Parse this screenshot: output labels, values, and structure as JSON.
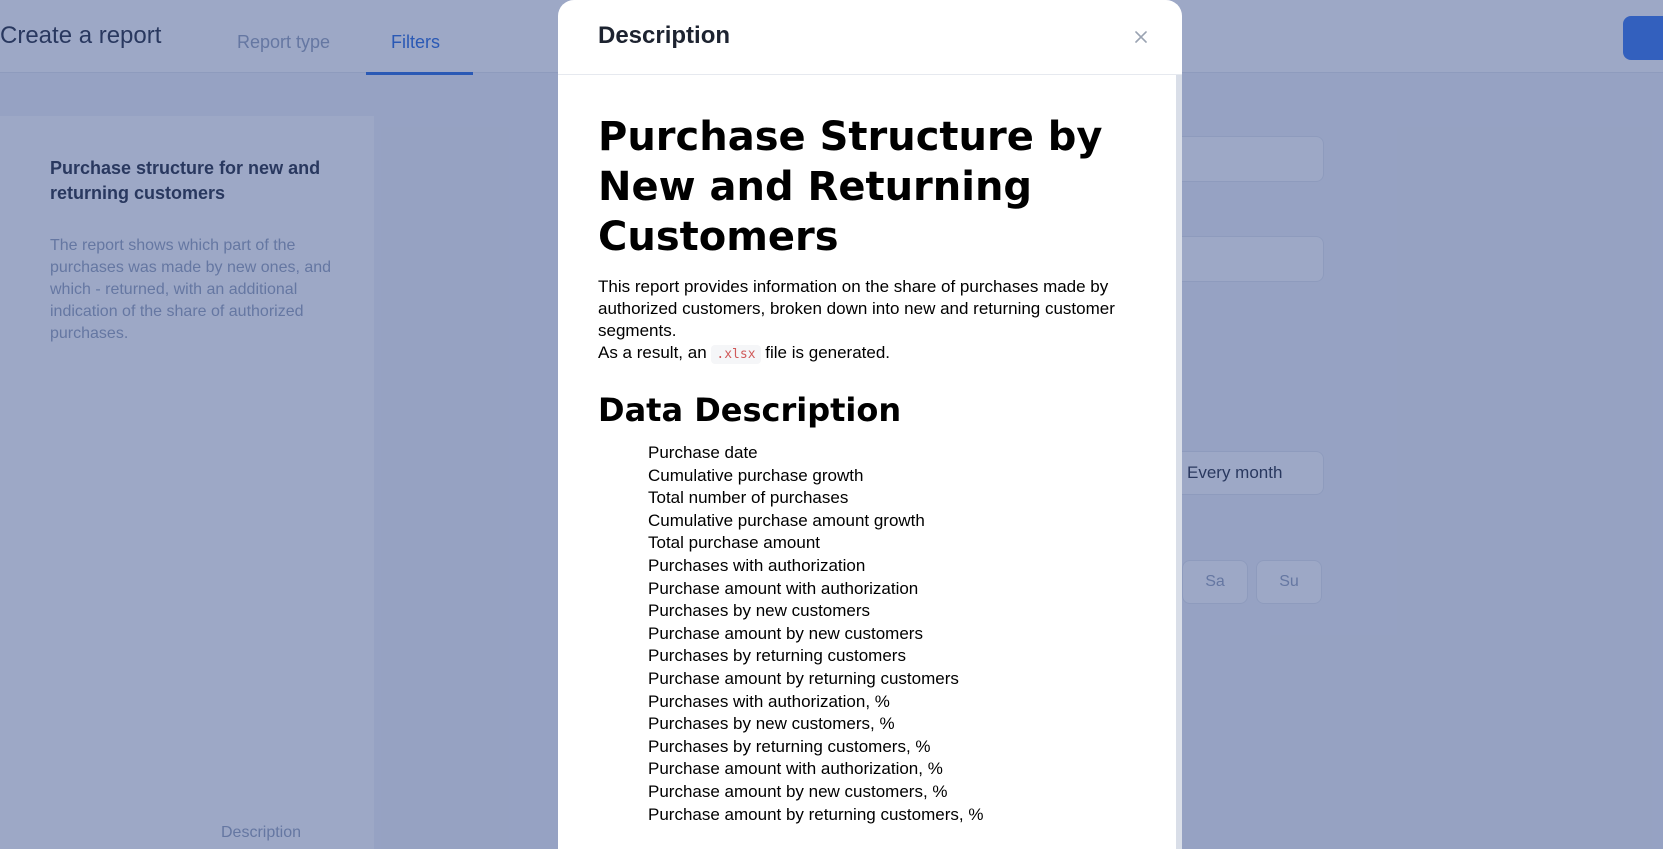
{
  "background": {
    "page_title": "Create a report",
    "tabs": [
      {
        "label": "Report type",
        "active": false
      },
      {
        "label": "Filters",
        "active": true
      }
    ],
    "side_card": {
      "title": "Purchase structure for new and returning customers",
      "description": "The report shows which part of the purchases was made by new ones, and which - returned, with an additional indication of the share of authorized purchases.",
      "link_label": "Description"
    },
    "period_value": "Every month",
    "weekdays": [
      "Sa",
      "Su"
    ]
  },
  "modal": {
    "title": "Description",
    "close_icon": "close-icon",
    "heading": "Purchase Structure by New and Returning Customers",
    "intro": "This report provides information on the share of purchases made by authorized customers, broken down into new and returning customer segments.",
    "result_prefix": "As a result, an",
    "result_code": ".xlsx",
    "result_suffix": "file is generated.",
    "data_heading": "Data Description",
    "fields": [
      "Purchase date",
      "Cumulative purchase growth",
      "Total number of purchases",
      "Cumulative purchase amount growth",
      "Total purchase amount",
      "Purchases with authorization",
      "Purchase amount with authorization",
      "Purchases by new customers",
      "Purchase amount by new customers",
      "Purchases by returning customers",
      "Purchase amount by returning customers",
      "Purchases with authorization, %",
      "Purchases by new customers, %",
      "Purchases by returning customers, %",
      "Purchase amount with authorization, %",
      "Purchase amount by new customers, %",
      "Purchase amount by returning customers, %"
    ]
  },
  "colors": {
    "overlay": "#253d80",
    "accent": "#2f6fe0",
    "code_text": "#d05a5a"
  }
}
